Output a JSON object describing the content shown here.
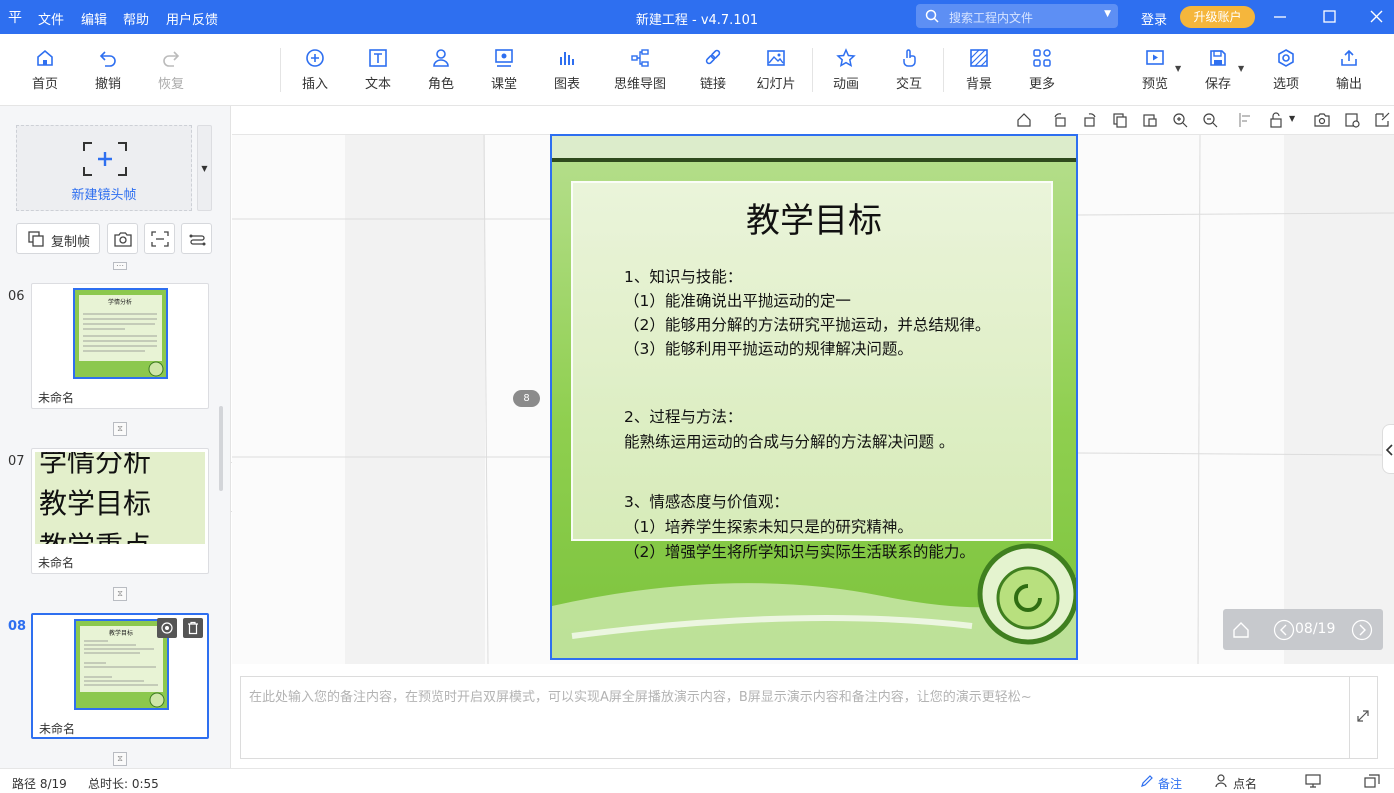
{
  "app": {
    "title": "新建工程 - v4.7.101",
    "menu": [
      "文件",
      "编辑",
      "帮助",
      "用户反馈"
    ],
    "search_placeholder": "搜索工程内文件",
    "login": "登录",
    "upgrade": "升级账户"
  },
  "toolbar": {
    "home": "首页",
    "undo": "撤销",
    "redo": "恢复",
    "insert": "插入",
    "text": "文本",
    "role": "角色",
    "class": "课堂",
    "chart": "图表",
    "mindmap": "思维导图",
    "link": "链接",
    "slideshow": "幻灯片",
    "animation": "动画",
    "interact": "交互",
    "background": "背景",
    "more": "更多",
    "preview": "预览",
    "save": "保存",
    "options": "选项",
    "export": "输出"
  },
  "left_panel": {
    "new_frame": "新建镜头帧",
    "copy_frame": "复制帧",
    "slides": [
      {
        "num": "06",
        "name": "未命名",
        "thumb_title": "学情分析",
        "active": false
      },
      {
        "num": "07",
        "name": "未命名",
        "thumb_lines": [
          "学情分析",
          "教学目标",
          "教学重点"
        ],
        "active": false
      },
      {
        "num": "08",
        "name": "未命名",
        "thumb_title": "教学目标",
        "active": true
      }
    ]
  },
  "canvas": {
    "path_badge": "8",
    "page_counter": "08/19"
  },
  "slide": {
    "title": "教学目标",
    "lines": [
      "1、知识与技能：",
      "（1）能准确说出平抛运动的定一",
      "（2）能够用分解的方法研究平抛运动，并总结规律。",
      "（3）能够利用平抛运动的规律解决问题。",
      "2、过程与方法：",
      "能熟练运用运动的合成与分解的方法解决问题 。",
      "3、情感态度与价值观：",
      "（1）培养学生探索未知只是的研究精神。",
      "（2）增强学生将所学知识与实际生活联系的能力。"
    ]
  },
  "notes": {
    "placeholder": "在此处输入您的备注内容，在预览时开启双屏模式，可以实现A屏全屏播放演示内容，B屏显示演示内容和备注内容，让您的演示更轻松~"
  },
  "status": {
    "path": "路径 8/19",
    "duration": "总时长: 0:55",
    "notes": "备注",
    "roll_call": "点名"
  },
  "colors": {
    "accent": "#2e6ff0",
    "upgrade": "#f5b63c",
    "slide_green": "#8fcf4f"
  }
}
